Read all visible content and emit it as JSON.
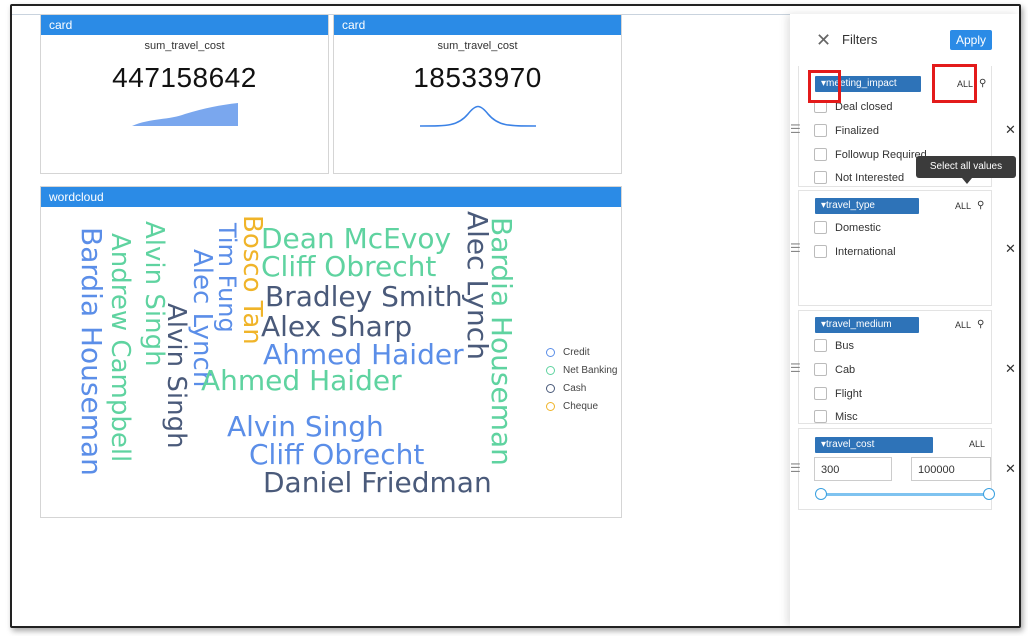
{
  "cards": [
    {
      "header": "card",
      "label": "sum_travel_cost",
      "value": "447158642"
    },
    {
      "header": "card",
      "label": "sum_travel_cost",
      "value": "18533970"
    }
  ],
  "wordcloud": {
    "header": "wordcloud",
    "words": [
      {
        "text": "Bardia Houseman",
        "color": "#5b8ee8"
      },
      {
        "text": "Andrew Campbell",
        "color": "#5fd3a0"
      },
      {
        "text": "Alvin Singh",
        "color": "#5fd3a0"
      },
      {
        "text": "Alvin Singh",
        "color": "#4a5a7a"
      },
      {
        "text": "Alec Lynch",
        "color": "#5b8ee8"
      },
      {
        "text": "Tim Fung",
        "color": "#5b8ee8"
      },
      {
        "text": "Bosco Tan",
        "color": "#f0b429"
      },
      {
        "text": "Dean McEvoy",
        "color": "#5fd3a0"
      },
      {
        "text": "Cliff Obrecht",
        "color": "#5fd3a0"
      },
      {
        "text": "Bradley Smith",
        "color": "#4a5a7a"
      },
      {
        "text": "Alex Sharp",
        "color": "#4a5a7a"
      },
      {
        "text": "Ahmed Haider",
        "color": "#5b8ee8"
      },
      {
        "text": "Ahmed Haider",
        "color": "#5fd3a0"
      },
      {
        "text": "Alvin Singh",
        "color": "#5b8ee8"
      },
      {
        "text": "Cliff Obrecht",
        "color": "#5b8ee8"
      },
      {
        "text": "Daniel Friedman",
        "color": "#4a5a7a"
      },
      {
        "text": "Alec Lynch",
        "color": "#4a5a7a"
      },
      {
        "text": "Bardia Houseman",
        "color": "#5fd3a0"
      }
    ],
    "legend": [
      {
        "label": "Credit",
        "color": "#5b8ee8"
      },
      {
        "label": "Net Banking",
        "color": "#5fd3a0"
      },
      {
        "label": "Cash",
        "color": "#4a5a7a"
      },
      {
        "label": "Cheque",
        "color": "#f0b429"
      }
    ]
  },
  "filters": {
    "title": "Filters",
    "apply_label": "Apply",
    "close_icon": "close-icon",
    "tooltip": "Select all values",
    "groups": [
      {
        "tag": "meeting_impact",
        "all": "ALL",
        "options": [
          "Deal closed",
          "Finalized",
          "Followup Required",
          "Not Interested"
        ]
      },
      {
        "tag": "travel_type",
        "all": "ALL",
        "options": [
          "Domestic",
          "International"
        ]
      },
      {
        "tag": "travel_medium",
        "all": "ALL",
        "options": [
          "Bus",
          "Cab",
          "Flight",
          "Misc"
        ]
      },
      {
        "tag": "travel_cost",
        "all": "ALL",
        "min": "300",
        "max": "100000"
      }
    ]
  }
}
